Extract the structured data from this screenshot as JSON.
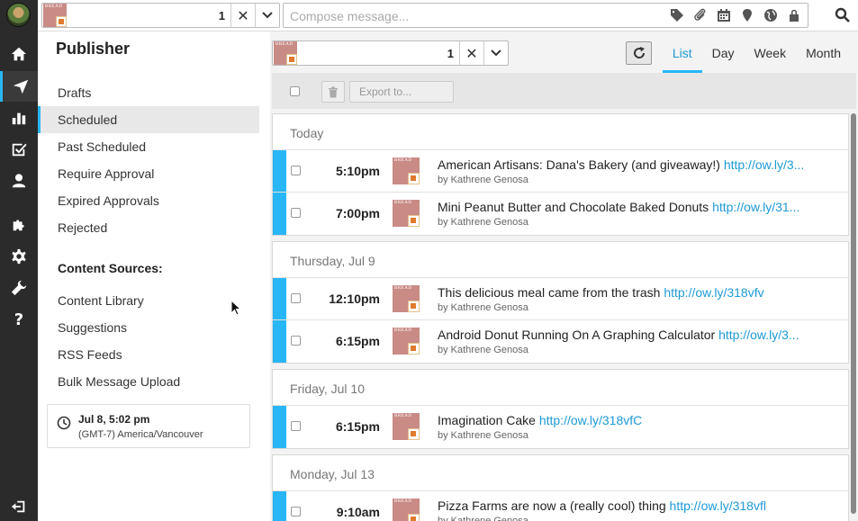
{
  "topbar": {
    "profile_count": "1",
    "compose_placeholder": "Compose message..."
  },
  "nav": {
    "items": [
      "home-icon",
      "paper-plane-icon",
      "bar-chart-icon",
      "checkbox-icon",
      "user-icon",
      "puzzle-icon",
      "gear-icon",
      "wrench-icon",
      "question-icon"
    ],
    "question_label": "?"
  },
  "sidepanel": {
    "title": "Publisher",
    "items": [
      "Drafts",
      "Scheduled",
      "Past Scheduled",
      "Require Approval",
      "Expired Approvals",
      "Rejected"
    ],
    "active_item": "Scheduled",
    "sources_heading": "Content Sources:",
    "sources": [
      "Content Library",
      "Suggestions",
      "RSS Feeds",
      "Bulk Message Upload"
    ],
    "time": "Jul 8, 5:02 pm",
    "timezone": "(GMT-7) America/Vancouver"
  },
  "main": {
    "profile_count": "1",
    "view_tabs": [
      "List",
      "Day",
      "Week",
      "Month"
    ],
    "active_tab": "List",
    "export_label": "Export to...",
    "thumb_label": "BREAD",
    "days": [
      {
        "label": "Today",
        "messages": [
          {
            "time": "5:10pm",
            "text": "American Artisans: Dana's Bakery (and giveaway!)",
            "link": "http://ow.ly/3...",
            "by": "by Kathrene Genosa"
          },
          {
            "time": "7:00pm",
            "text": "Mini Peanut Butter and Chocolate Baked Donuts",
            "link": "http://ow.ly/31...",
            "by": "by Kathrene Genosa"
          }
        ]
      },
      {
        "label": "Thursday, Jul 9",
        "messages": [
          {
            "time": "12:10pm",
            "text": "This delicious meal came from the trash",
            "link": "http://ow.ly/318vfv",
            "by": "by Kathrene Genosa"
          },
          {
            "time": "6:15pm",
            "text": "Android Donut Running On A Graphing Calculator",
            "link": "http://ow.ly/3...",
            "by": "by Kathrene Genosa"
          }
        ]
      },
      {
        "label": "Friday, Jul 10",
        "messages": [
          {
            "time": "6:15pm",
            "text": "Imagination Cake",
            "link": "http://ow.ly/318vfC",
            "by": "by Kathrene Genosa"
          }
        ]
      },
      {
        "label": "Monday, Jul 13",
        "messages": [
          {
            "time": "9:10am",
            "text": "Pizza Farms are now a (really cool) thing",
            "link": "http://ow.ly/318vfl",
            "by": "by Kathrene Genosa"
          }
        ]
      }
    ]
  },
  "colors": {
    "accent": "#29b6f6",
    "nav_bg": "#2b2b2b",
    "link": "#1e9ad6"
  }
}
